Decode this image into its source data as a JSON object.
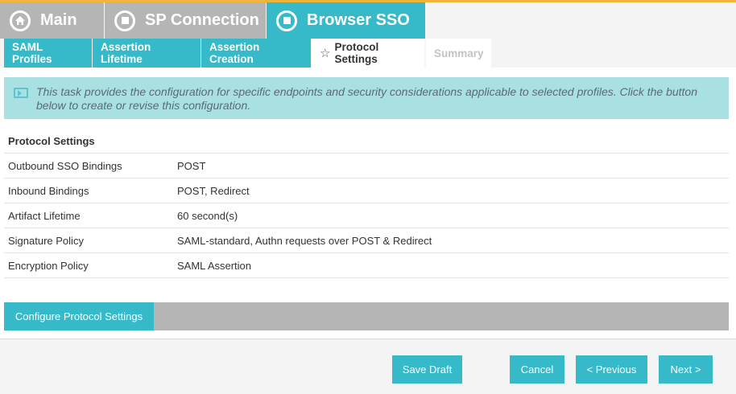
{
  "main_tabs": {
    "main": "Main",
    "sp_connection": "SP Connection",
    "browser_sso": "Browser SSO"
  },
  "sub_tabs": [
    {
      "label": "SAML Profiles"
    },
    {
      "label": "Assertion Lifetime"
    },
    {
      "label": "Assertion Creation"
    },
    {
      "label": "Protocol Settings"
    },
    {
      "label": "Summary"
    }
  ],
  "info": {
    "text": "This task provides the configuration for specific endpoints and security considerations applicable to selected profiles. Click the button below to create or revise this configuration."
  },
  "table": {
    "header": "Protocol Settings",
    "rows": [
      {
        "label": "Outbound SSO Bindings",
        "value": "POST"
      },
      {
        "label": "Inbound Bindings",
        "value": "POST, Redirect"
      },
      {
        "label": "Artifact Lifetime",
        "value": "60 second(s)"
      },
      {
        "label": "Signature Policy",
        "value": "SAML-standard, Authn requests over POST & Redirect"
      },
      {
        "label": "Encryption Policy",
        "value": "SAML Assertion"
      }
    ]
  },
  "configure_button": "Configure Protocol Settings",
  "footer": {
    "save_draft": "Save Draft",
    "cancel": "Cancel",
    "previous": "< Previous",
    "next": "Next >"
  },
  "colors": {
    "accent": "#36b9c8",
    "inactive_tab": "#b5b5b5",
    "info_bg": "#a9e0e2",
    "top_line": "#f2b53a"
  }
}
